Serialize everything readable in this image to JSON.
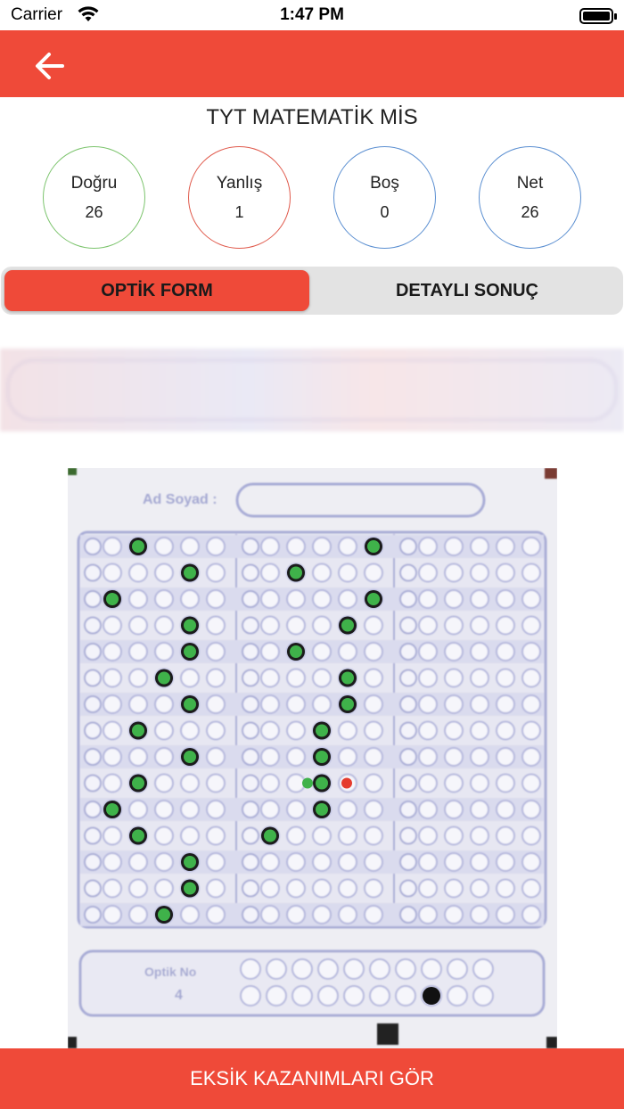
{
  "status_bar": {
    "carrier": "Carrier",
    "time": "1:47 PM"
  },
  "nav": {
    "back_icon": "arrow-left-icon"
  },
  "exam": {
    "title": "TYT MATEMATİK MİS"
  },
  "stats": [
    {
      "label": "Doğru",
      "value": "26",
      "color": "#7cc46d"
    },
    {
      "label": "Yanlış",
      "value": "1",
      "color": "#e05a4c"
    },
    {
      "label": "Boş",
      "value": "0",
      "color": "#5b8fd1"
    },
    {
      "label": "Net",
      "value": "26",
      "color": "#5b8fd1"
    }
  ],
  "tabs": {
    "optik": "OPTİK FORM",
    "detayli": "DETAYLI SONUÇ",
    "active": "optik"
  },
  "sheet": {
    "name_label": "Ad Soyad",
    "optik_no_label": "Optik No",
    "optik_no_value": "4"
  },
  "colors": {
    "accent": "#ef4a39",
    "correct": "#3fb24a",
    "wrong": "#e53b2e"
  },
  "footer": {
    "button_label": "EKSİK KAZANIMLARI GÖR"
  }
}
